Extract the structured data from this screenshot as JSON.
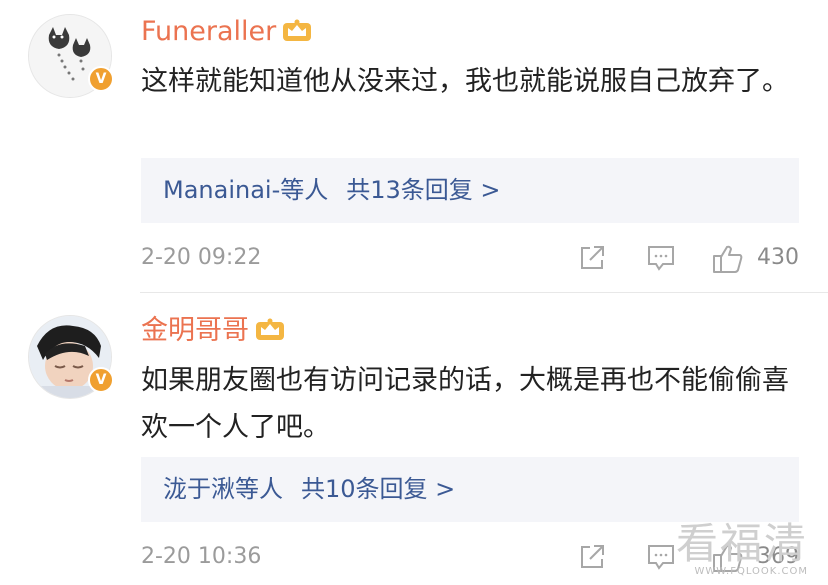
{
  "comments": [
    {
      "username": "Funeraller",
      "text": "这样就能知道他从没来过，我也就能说服自己放弃了。",
      "reply_names": "Manainai-等人",
      "reply_count": "共13条回复 >",
      "time": "2-20 09:22",
      "likes": "430"
    },
    {
      "username": "金明哥哥",
      "text": "如果朋友圈也有访问记录的话，大概是再也不能偷偷喜欢一个人了吧。",
      "reply_names": "泷于湫等人",
      "reply_count": "共10条回复 >",
      "time": "2-20 10:36",
      "likes": "369"
    }
  ],
  "badge_letter": "V",
  "watermark": {
    "main": "看福清",
    "sub": "WWW.FQLOOK.COM"
  },
  "colors": {
    "username": "#eb7350",
    "reply_link": "#3b5994",
    "meta": "#9b9b9b",
    "badge": "#f0a030"
  }
}
